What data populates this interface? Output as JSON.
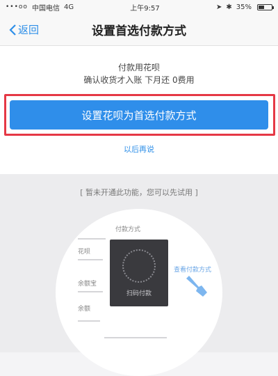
{
  "status_bar": {
    "signal": "•••oo",
    "carrier": "中国电信",
    "network": "4G",
    "time": "上午9:57",
    "battery": "35%"
  },
  "nav": {
    "back_label": "返回",
    "title": "设置首选付款方式"
  },
  "info": {
    "title": "付款用花呗",
    "subtitle": "确认收货才入账 下月还 0费用"
  },
  "primary_button": {
    "label": "设置花呗为首选付款方式"
  },
  "secondary_link": {
    "label": "以后再说"
  },
  "tutorial": {
    "caption": "[ 暂未开通此功能，您可以先试用 ]",
    "qr_text": "扫码付款",
    "side_text": "查看付款方式",
    "labels": [
      "付款方式",
      "花呗",
      "余额宝",
      "余额"
    ]
  },
  "colors": {
    "accent": "#2f8eea",
    "highlight": "#e53845"
  },
  "icons": {
    "back": "chevron-left-icon",
    "location": "location-icon",
    "bluetooth": "bluetooth-icon",
    "qr": "qr-code-icon",
    "finger": "pointing-hand-icon"
  }
}
